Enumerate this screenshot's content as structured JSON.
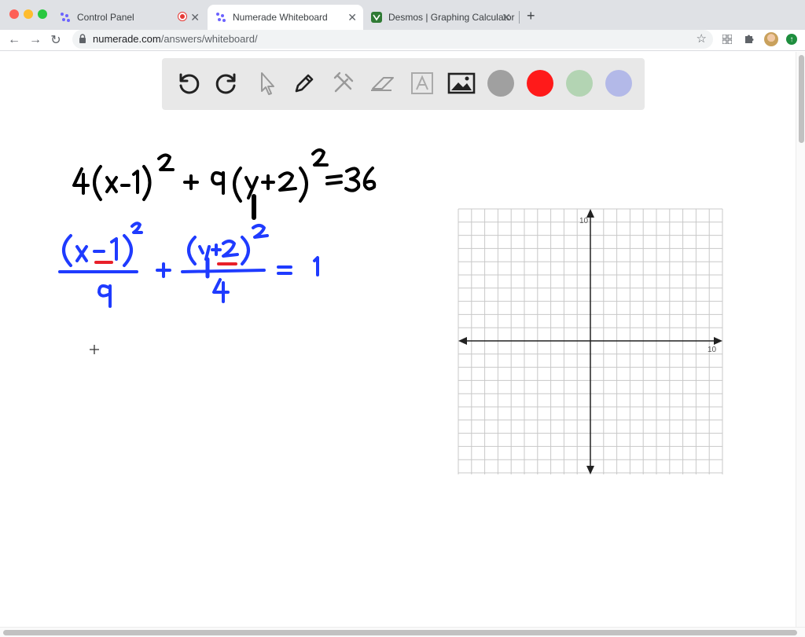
{
  "browser": {
    "tabs": [
      {
        "title": "Control Panel",
        "favicon": "numerade-logo-icon",
        "recording": true
      },
      {
        "title": "Numerade Whiteboard",
        "favicon": "numerade-logo-icon",
        "active": true
      },
      {
        "title": "Desmos | Graphing Calculator",
        "favicon": "desmos-logo-icon"
      }
    ],
    "url_host": "numerade.com",
    "url_path": "/answers/whiteboard/"
  },
  "toolbar": {
    "tools": [
      "undo-icon",
      "redo-icon",
      "pointer-icon",
      "pen-icon",
      "tools-icon",
      "eraser-icon",
      "text-icon",
      "image-icon"
    ],
    "colors": [
      "#a0a0a0",
      "#ff1a1a",
      "#b3d4b3",
      "#b3b9e8"
    ]
  },
  "colors": {
    "ink_black": "#000000",
    "ink_blue": "#1f3bff",
    "ink_red": "#e8202a"
  },
  "graph": {
    "x_max_label": "10",
    "y_max_label": "10"
  },
  "handwriting": {
    "line1": "4(x-1)^2 + 9(y+2)^2 = 36",
    "line2": "(x-1)^2/9 + (y+2)^2/4 = 1"
  }
}
